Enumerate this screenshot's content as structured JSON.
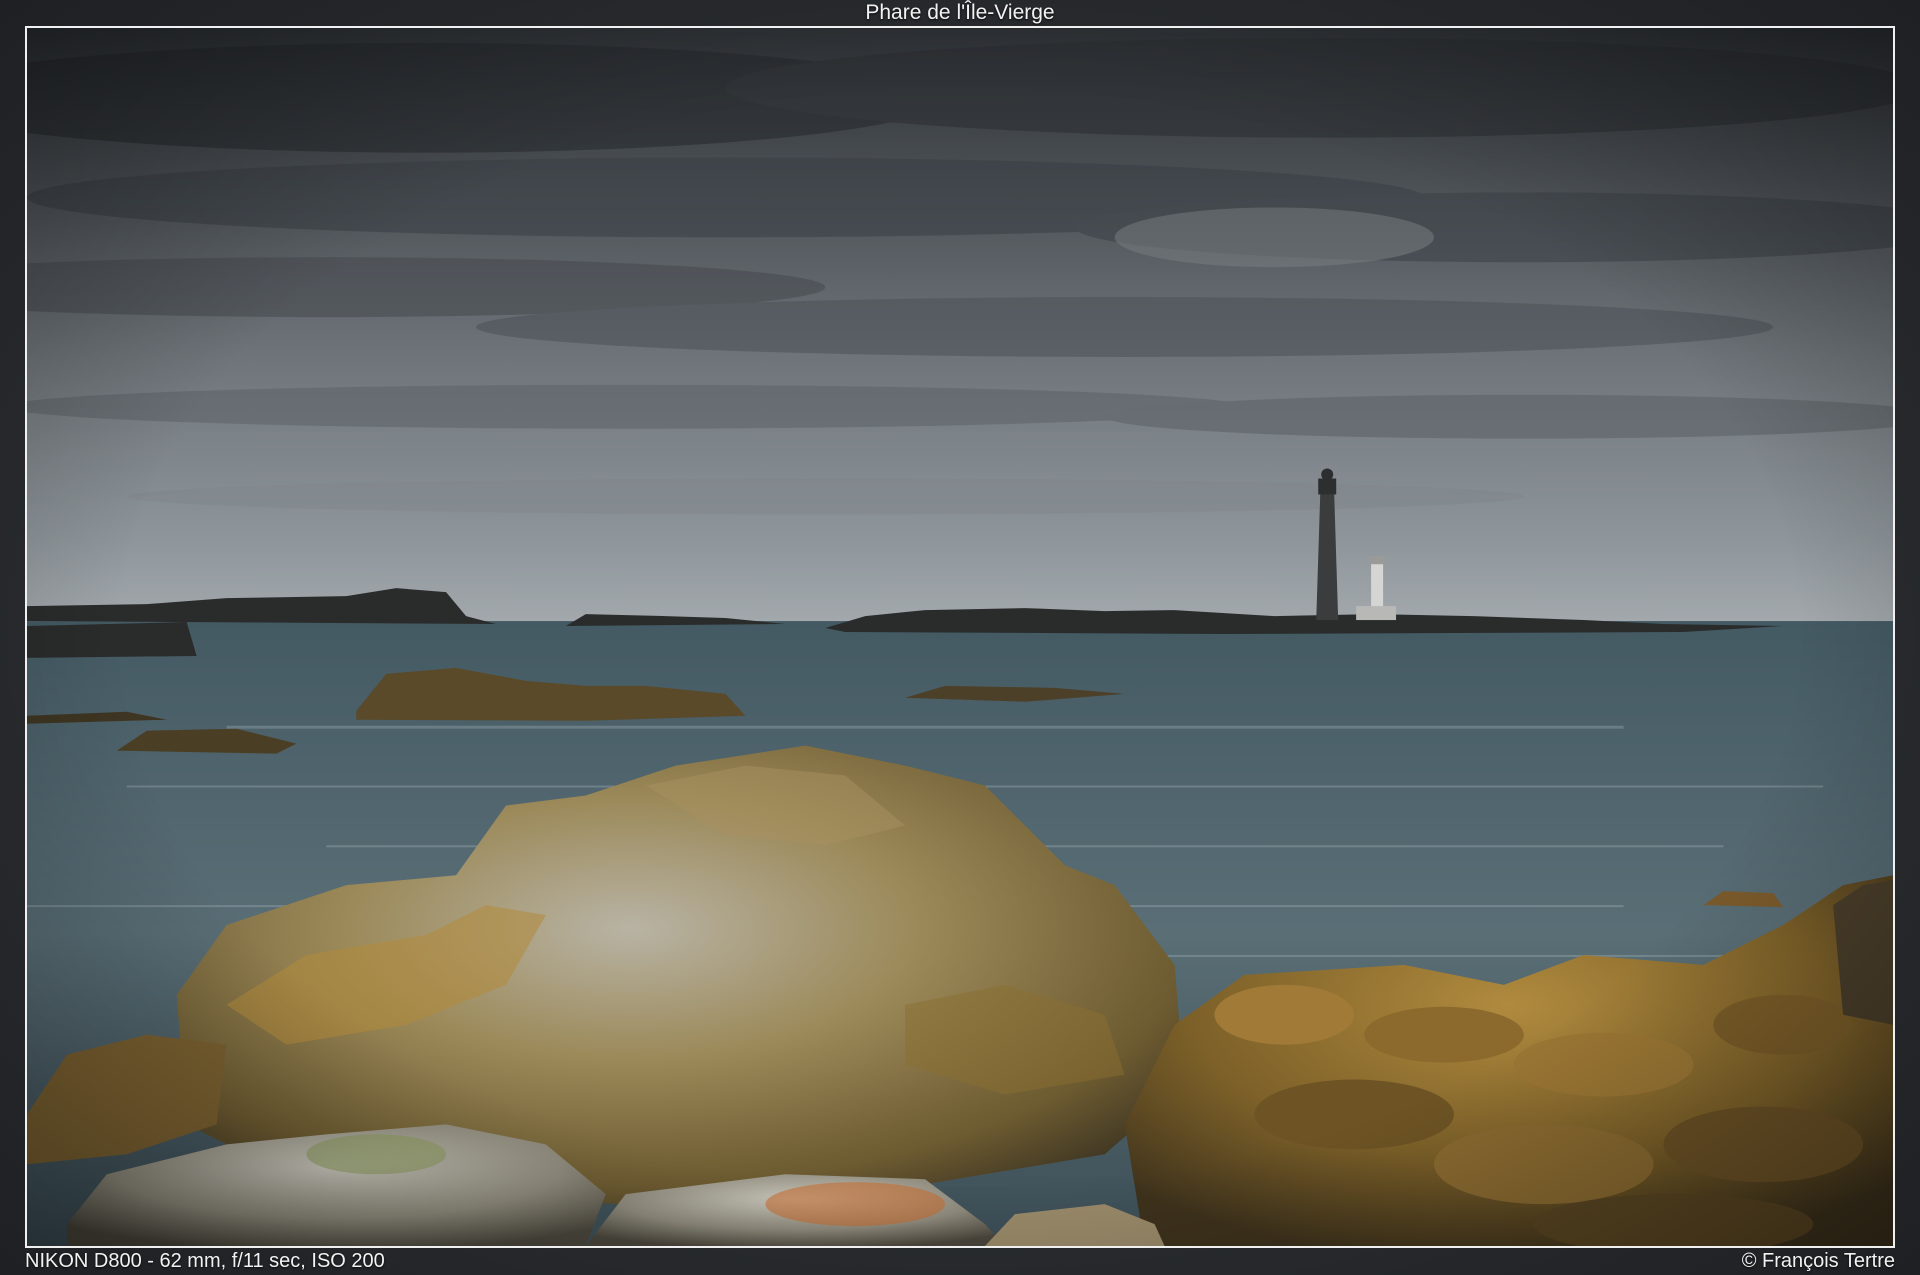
{
  "title": "Phare de l'Île-Vierge",
  "exif": "NIKON D800 - 62 mm, f/11 sec, ISO 200",
  "copyright": "© François Tertre",
  "colors": {
    "sky_dark": "#2f3337",
    "sky_mid": "#6a7075",
    "sky_light": "#9aa0a4",
    "sea": "#52656d",
    "rock_ochre": "#9a7a38",
    "lichen": "#c07a2a",
    "frame_border": "#f0f0f0"
  }
}
